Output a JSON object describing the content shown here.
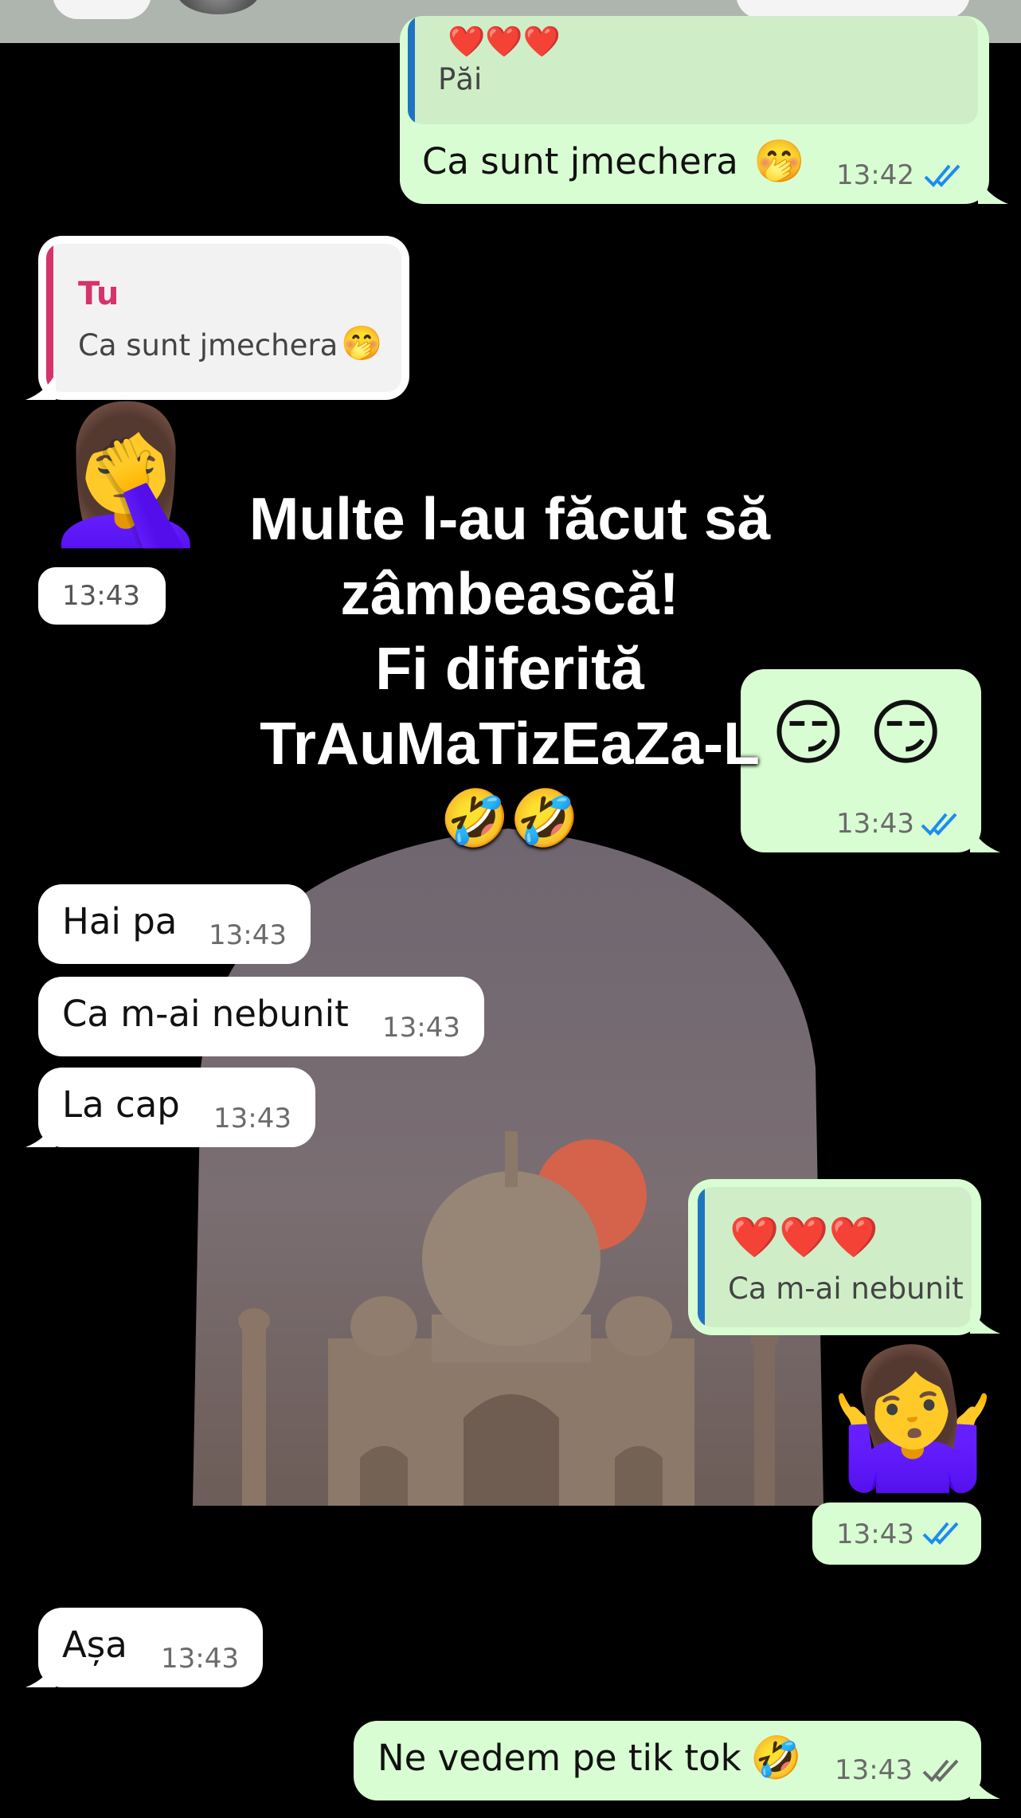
{
  "colors": {
    "background": "#000000",
    "incoming_bubble": "#ffffff",
    "outgoing_bubble": "#d9fdd3",
    "read_tick": "#1d8cf0",
    "sent_tick": "#6b6b6b",
    "quote_author": "#d6336c",
    "quote_bar_in": "#d6336c",
    "quote_bar_out": "#1f74c2"
  },
  "messages": [
    {
      "id": "m1",
      "dir": "out",
      "quote_text": "Păi",
      "text": "Ca sunt jmechera",
      "emoji": "🤭",
      "time": "13:42",
      "ticks": "read"
    },
    {
      "id": "m2",
      "dir": "in",
      "quote_author": "Tu",
      "quote_text": "Ca sunt jmechera",
      "quote_emoji": "🤭"
    },
    {
      "id": "m3",
      "dir": "in",
      "sticker": "🤦‍♀️",
      "time": "13:43"
    },
    {
      "id": "m4",
      "dir": "out",
      "emoji": "😏 😏",
      "time": "13:43",
      "ticks": "read"
    },
    {
      "id": "m5",
      "dir": "in",
      "text": "Hai pa",
      "time": "13:43"
    },
    {
      "id": "m6",
      "dir": "in",
      "text": "Ca m-ai nebunit",
      "time": "13:43"
    },
    {
      "id": "m7",
      "dir": "in",
      "text": "La cap",
      "time": "13:43"
    },
    {
      "id": "m8",
      "dir": "out",
      "hearts": "❤️❤️❤️",
      "quote_text": "Ca m-ai nebunit"
    },
    {
      "id": "m9",
      "dir": "out",
      "sticker": "🤷‍♀️",
      "time": "13:43",
      "ticks": "read"
    },
    {
      "id": "m10",
      "dir": "in",
      "text": "Așa",
      "time": "13:43"
    },
    {
      "id": "m11",
      "dir": "out",
      "text": "Ne vedem pe tik tok",
      "emoji": "🤣",
      "time": "13:43",
      "ticks": "sent"
    }
  ],
  "top_reaction": "❤️❤️❤️",
  "overlay": {
    "line1": "Multe l-au făcut să",
    "line2": "zâmbească!",
    "line3": "Fi diferită",
    "line4": "TrAuMaTizEaZa-L",
    "emoji": "🤣🤣"
  }
}
